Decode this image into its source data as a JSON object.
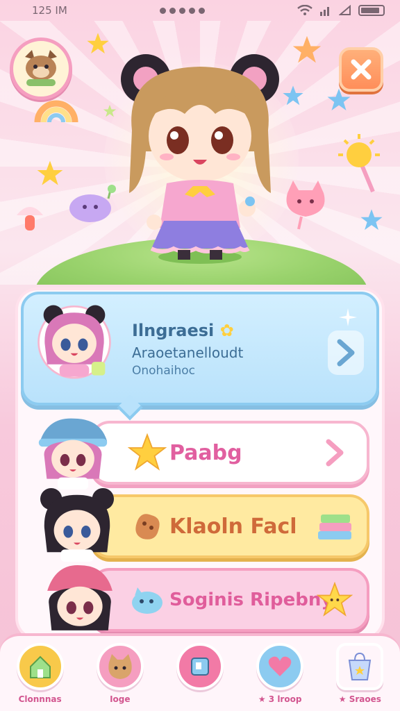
{
  "status": {
    "time": "125 IM"
  },
  "hero": {
    "character": "chibi girl with bear ears"
  },
  "featured": {
    "title": "Ilngraesi",
    "subtitle": "Araoetanelloudt",
    "caption": "Onohaihoc"
  },
  "rows": [
    {
      "label": "Paabg",
      "icon": "star-icon",
      "right_icon": "chevron-right-icon"
    },
    {
      "label": "Klaoln Facl",
      "icon": "cookie-icon",
      "right_icon": "book-stack-icon"
    },
    {
      "label": "Soginis Ripebny",
      "icon": "blue-pet-icon",
      "right_icon": "star-face-icon"
    }
  ],
  "nav": [
    {
      "label": "Clonnnas",
      "icon": "home-icon",
      "color": "#f8c94a"
    },
    {
      "label": "Ioge",
      "icon": "cat-icon",
      "color": "#f59ec0"
    },
    {
      "label": "",
      "icon": "inventory-icon",
      "color": "#f27aa6"
    },
    {
      "label": "★ 3 lroop",
      "icon": "heart-icon",
      "color": "#8ccbf0"
    },
    {
      "label": "★ Sraoes",
      "icon": "shop-bag-icon",
      "color": "#fff5fa"
    }
  ],
  "colors": {
    "accent_pink": "#f59ec0",
    "featured_blue": "#b9e2fb",
    "yellow_row": "#ffeaa1"
  }
}
